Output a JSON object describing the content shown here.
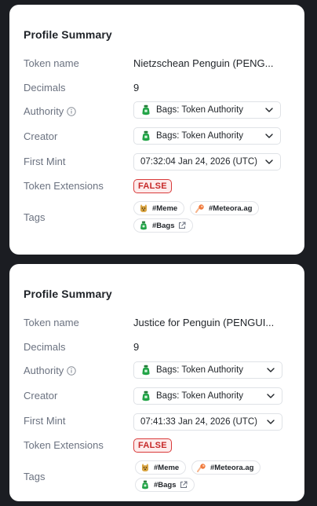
{
  "cards": [
    {
      "title": "Profile Summary",
      "labels": {
        "token_name": "Token name",
        "decimals": "Decimals",
        "authority": "Authority",
        "creator": "Creator",
        "first_mint": "First Mint",
        "token_extensions": "Token Extensions",
        "tags": "Tags"
      },
      "token_name": "Nietzschean Penguin (PENG...",
      "decimals": "9",
      "authority": "Bags: Token Authority",
      "creator": "Bags: Token Authority",
      "first_mint": "07:32:04 Jan 24, 2026 (UTC)",
      "token_extensions": "FALSE",
      "tags": [
        "#Meme",
        "#Meteora.ag",
        "#Bags"
      ]
    },
    {
      "title": "Profile Summary",
      "labels": {
        "token_name": "Token name",
        "decimals": "Decimals",
        "authority": "Authority",
        "creator": "Creator",
        "first_mint": "First Mint",
        "token_extensions": "Token Extensions",
        "tags": "Tags"
      },
      "token_name": "Justice for Penguin (PENGUI...",
      "decimals": "9",
      "authority": "Bags: Token Authority",
      "creator": "Bags: Token Authority",
      "first_mint": "07:41:33 Jan 24, 2026 (UTC)",
      "token_extensions": "FALSE",
      "tags": [
        "#Meme",
        "#Meteora.ag",
        "#Bags"
      ]
    }
  ],
  "icons": {
    "authority_info": "info-circle-icon",
    "select": "bags-money-bag-icon",
    "dropdown": "chevron-down-icon",
    "tag_meme": "meme-dog-icon",
    "tag_meteora": "meteora-comet-icon",
    "tag_bags": "bags-money-bag-icon",
    "tag_bags_external": "external-link-icon"
  },
  "colors": {
    "background": "#1b1d22",
    "card": "#ffffff",
    "false_badge_border": "#d93a3a",
    "false_badge_text": "#c62828",
    "bags_green": "#22a447"
  }
}
